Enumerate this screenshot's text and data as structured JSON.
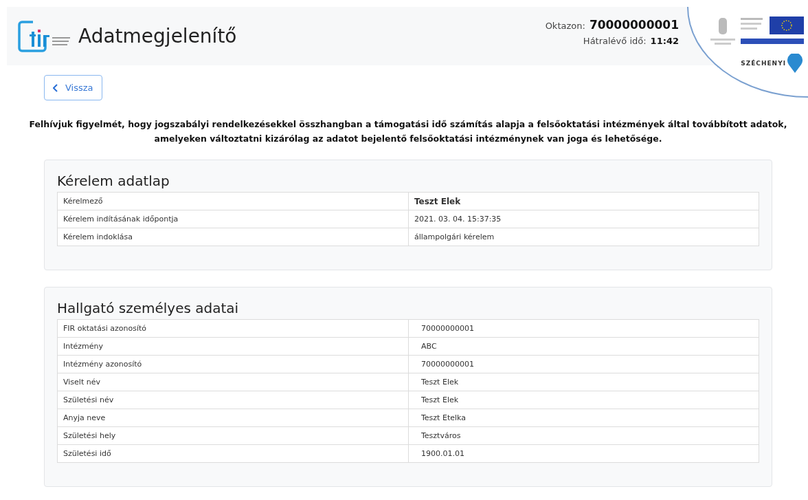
{
  "header": {
    "title": "Adatmegjelenítő",
    "oktazon_label": "Oktazon:",
    "oktazon_value": "70000000001",
    "time_label": "Hátralévő idő:",
    "time_value": "11:42",
    "sponsor_text": "SZÉCHENYI"
  },
  "back_button": {
    "label": "Vissza"
  },
  "notice": "Felhívjuk figyelmét, hogy jogszabályi rendelkezésekkel összhangban a támogatási idő számítás alapja a felsőoktatási intézmények által továbbított adatok, amelyeken változtatni kizárólag az adatot bejelentő felsőoktatási intézménynek van joga és lehetősége.",
  "sections": [
    {
      "title": "Kérelem adatlap",
      "rows": [
        {
          "label": "Kérelmező",
          "value": "Teszt Elek",
          "bold": true
        },
        {
          "label": "Kérelem indításának időpontja",
          "value": "2021. 03. 04. 15:37:35",
          "bold": false
        },
        {
          "label": "Kérelem indoklása",
          "value": "állampolgári kérelem",
          "bold": false
        }
      ]
    },
    {
      "title": "Hallgató személyes adatai",
      "rows": [
        {
          "label": "FIR oktatási azonosító",
          "value": "70000000001",
          "bold": false
        },
        {
          "label": "Intézmény",
          "value": "ABC",
          "bold": false
        },
        {
          "label": "Intézmény azonosító",
          "value": "70000000001",
          "bold": false
        },
        {
          "label": "Viselt név",
          "value": "Teszt Elek",
          "bold": false
        },
        {
          "label": "Születési név",
          "value": "Teszt Elek",
          "bold": false
        },
        {
          "label": "Anyja neve",
          "value": "Teszt Etelka",
          "bold": false
        },
        {
          "label": "Születési hely",
          "value": "Tesztváros",
          "bold": false
        },
        {
          "label": "Születési idő",
          "value": "1900.01.01",
          "bold": false
        }
      ]
    }
  ]
}
